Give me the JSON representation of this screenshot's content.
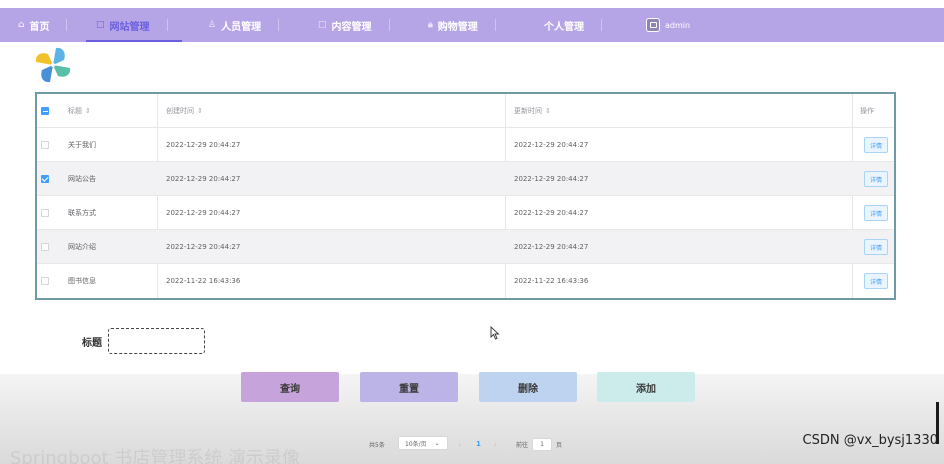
{
  "nav": {
    "items": [
      {
        "label": "首页",
        "icon": "home-icon"
      },
      {
        "label": "网站管理",
        "icon": "square-icon"
      },
      {
        "label": "人员管理",
        "icon": "user-icon"
      },
      {
        "label": "内容管理",
        "icon": "square-icon"
      },
      {
        "label": "购物管理",
        "icon": "lock-icon"
      },
      {
        "label": "个人管理",
        "icon": ""
      }
    ],
    "user": "admin",
    "active_color": "#6b5fe0",
    "bar_color": "#b6a5e6"
  },
  "table": {
    "headers": {
      "title": "标题",
      "created": "创建时间",
      "updated": "更新时间",
      "action": "操作"
    },
    "sort_glyph": "⇕",
    "rows": [
      {
        "title": "关于我们",
        "created": "2022-12-29 20:44:27",
        "updated": "2022-12-29 20:44:27",
        "action": "详情"
      },
      {
        "title": "网站公告",
        "created": "2022-12-29 20:44:27",
        "updated": "2022-12-29 20:44:27",
        "action": "详情"
      },
      {
        "title": "联系方式",
        "created": "2022-12-29 20:44:27",
        "updated": "2022-12-29 20:44:27",
        "action": "详情"
      },
      {
        "title": "网站介绍",
        "created": "2022-12-29 20:44:27",
        "updated": "2022-12-29 20:44:27",
        "action": "详情"
      },
      {
        "title": "图书信息",
        "created": "2022-11-22 16:43:36",
        "updated": "2022-11-22 16:43:36",
        "action": "详情"
      }
    ]
  },
  "search": {
    "label": "标题",
    "value": "",
    "placeholder": ""
  },
  "buttons": {
    "query": "查询",
    "reset": "重置",
    "delete": "删除",
    "add": "添加"
  },
  "pager": {
    "total": "共5条",
    "size": "10条/页",
    "prev": "‹",
    "page": "1",
    "next": "›",
    "goto": "前往",
    "goto_value": "1",
    "page_unit": "页"
  },
  "watermark": "CSDN @vx_bysj1330",
  "ghost_title": "Springboot 书店管理系统 演示录像"
}
